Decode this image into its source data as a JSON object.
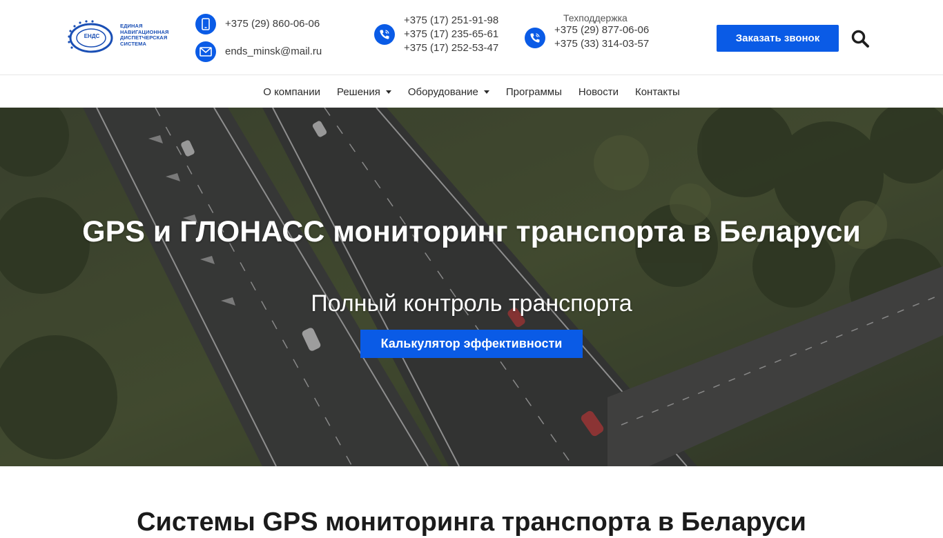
{
  "logo": {
    "badge_text": "ЕНДС",
    "lines": [
      "Единая",
      "навигационная",
      "диспетчерская",
      "система"
    ]
  },
  "header": {
    "mobile_phone": "+375 (29) 860-06-06",
    "email": "ends_minsk@mail.ru",
    "city_phones": [
      "+375 (17) 251-91-98",
      "+375 (17) 235-65-61",
      "+375 (17) 252-53-47"
    ],
    "support_title": "Техподдержка",
    "support_phones": [
      "+375 (29) 877-06-06",
      "+375 (33) 314-03-57"
    ],
    "call_button": "Заказать звонок",
    "icons": {
      "mobile": "smartphone-icon",
      "email": "envelope-icon",
      "phone": "phone-call-icon",
      "search": "search-icon"
    }
  },
  "nav": {
    "items": [
      {
        "label": "О компании",
        "has_dropdown": false
      },
      {
        "label": "Решения",
        "has_dropdown": true
      },
      {
        "label": "Оборудование",
        "has_dropdown": true
      },
      {
        "label": "Программы",
        "has_dropdown": false
      },
      {
        "label": "Новости",
        "has_dropdown": false
      },
      {
        "label": "Контакты",
        "has_dropdown": false
      }
    ]
  },
  "hero": {
    "title": "GPS и ГЛОНАСС мониторинг транспорта в Беларуси",
    "subtitle": "Полный контроль транспорта",
    "button": "Калькулятор эффективности"
  },
  "section": {
    "title": "Системы GPS мониторинга транспорта в Беларуси"
  },
  "colors": {
    "accent": "#0a5be6",
    "text": "#2b2b2b"
  }
}
